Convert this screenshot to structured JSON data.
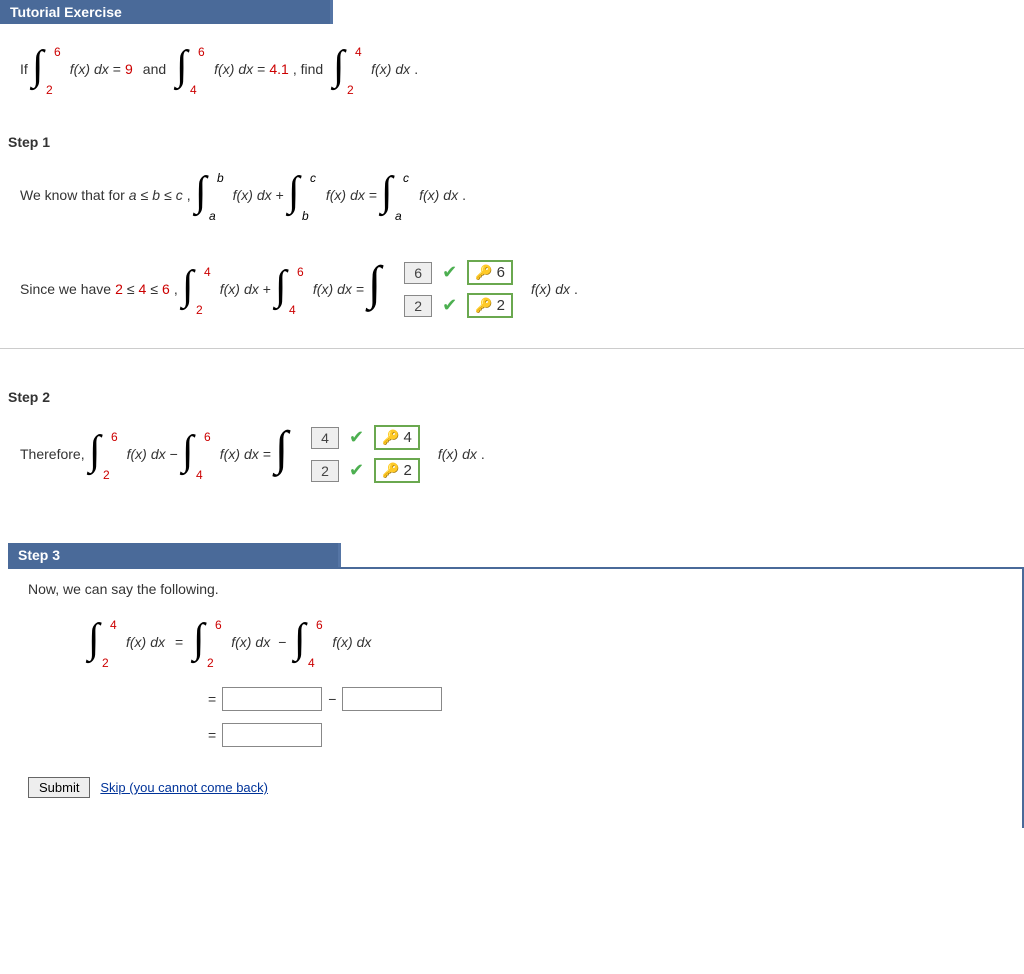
{
  "header": {
    "title": "Tutorial Exercise"
  },
  "exercise": {
    "if": "If",
    "and": "and",
    "find": ", find",
    "val1": "9",
    "val2": "4.1",
    "b1u": "6",
    "b1l": "2",
    "b2u": "6",
    "b2l": "4",
    "b3u": "4",
    "b3l": "2"
  },
  "fx": "f(x)",
  "dx": " dx",
  "eq": " = ",
  "plus": " + ",
  "minus": " − ",
  "period": ".",
  "le": " ≤ ",
  "step1": {
    "title": "Step 1",
    "line1": "We know that for ",
    "a": "a",
    "b": "b",
    "c": "c",
    "comma": ",",
    "line2": "Since we have ",
    "n2": "2",
    "n4": "4",
    "n6": "6",
    "ans_top": "6",
    "ans_bot": "2",
    "key_top": "6",
    "key_bot": "2"
  },
  "step2": {
    "title": "Step 2",
    "therefore": "Therefore,",
    "ans_top": "4",
    "ans_bot": "2",
    "key_top": "4",
    "key_bot": "2",
    "b1u": "6",
    "b1l": "2",
    "b2u": "6",
    "b2l": "4"
  },
  "step3": {
    "title": "Step 3",
    "line1": "Now, we can say the following.",
    "b1u": "4",
    "b1l": "2",
    "b2u": "6",
    "b2l": "2",
    "b3u": "6",
    "b3l": "4",
    "submit": "Submit",
    "skip": "Skip (you cannot come back)"
  }
}
